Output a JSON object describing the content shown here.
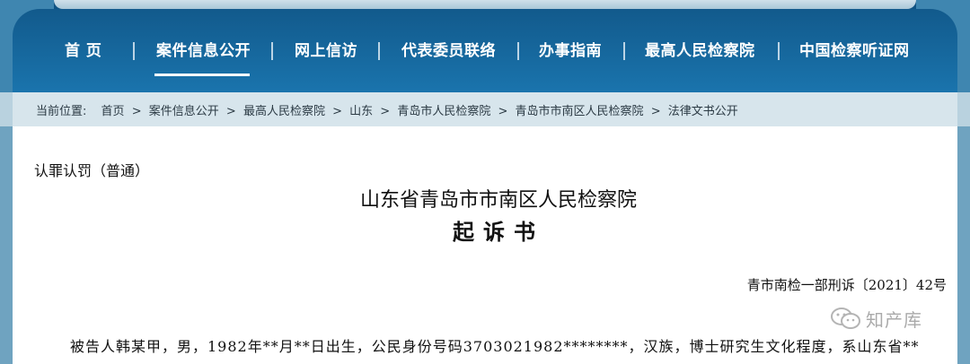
{
  "nav": {
    "items": [
      {
        "label": "首 页"
      },
      {
        "label": "案件信息公开"
      },
      {
        "label": "网上信访"
      },
      {
        "label": "代表委员联络"
      },
      {
        "label": "办事指南"
      },
      {
        "label": "最高人民检察院"
      },
      {
        "label": "中国检察听证网"
      }
    ],
    "active": "案件信息公开"
  },
  "breadcrumb": {
    "prefix": "当前位置:",
    "items": [
      "首页",
      "案件信息公开",
      "最高人民检察院",
      "山东",
      "青岛市人民检察院",
      "青岛市市南区人民检察院",
      "法律文书公开"
    ],
    "separator": ">"
  },
  "document": {
    "case_type": "认罪认罚（普通）",
    "organization": "山东省青岛市市南区人民检察院",
    "title": "起诉书",
    "number": "青市南检一部刑诉〔2021〕42号",
    "body_first_line": "被告人韩某甲，男，1982年**月**日出生，公民身份号码3703021982********，汉族，博士研究生文化程度，系山东省**"
  },
  "watermark": {
    "icon": "wechat-icon",
    "text": "知产库"
  },
  "colors": {
    "nav_bg": "#1469a0",
    "crumb_bg": "#d7e5ec",
    "page_bg": "#ffffff"
  }
}
